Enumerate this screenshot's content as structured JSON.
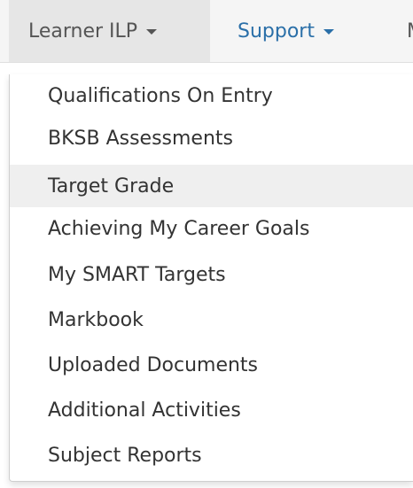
{
  "navbar": {
    "items": [
      {
        "label": "Learner ILP"
      },
      {
        "label": "Support"
      },
      {
        "label": "M"
      }
    ]
  },
  "dropdown": {
    "items": [
      {
        "label": "Qualifications On Entry"
      },
      {
        "label": "BKSB Assessments"
      },
      {
        "label": "Target Grade",
        "highlighted": true
      },
      {
        "label": "Achieving My Career Goals"
      },
      {
        "label": "My SMART Targets"
      },
      {
        "label": "Markbook"
      },
      {
        "label": "Uploaded Documents"
      },
      {
        "label": "Additional Activities"
      },
      {
        "label": "Subject Reports"
      }
    ]
  },
  "colors": {
    "active_nav_bg": "#e6e6e6",
    "link": "#2a6fa8",
    "hover_bg": "#efefef"
  }
}
